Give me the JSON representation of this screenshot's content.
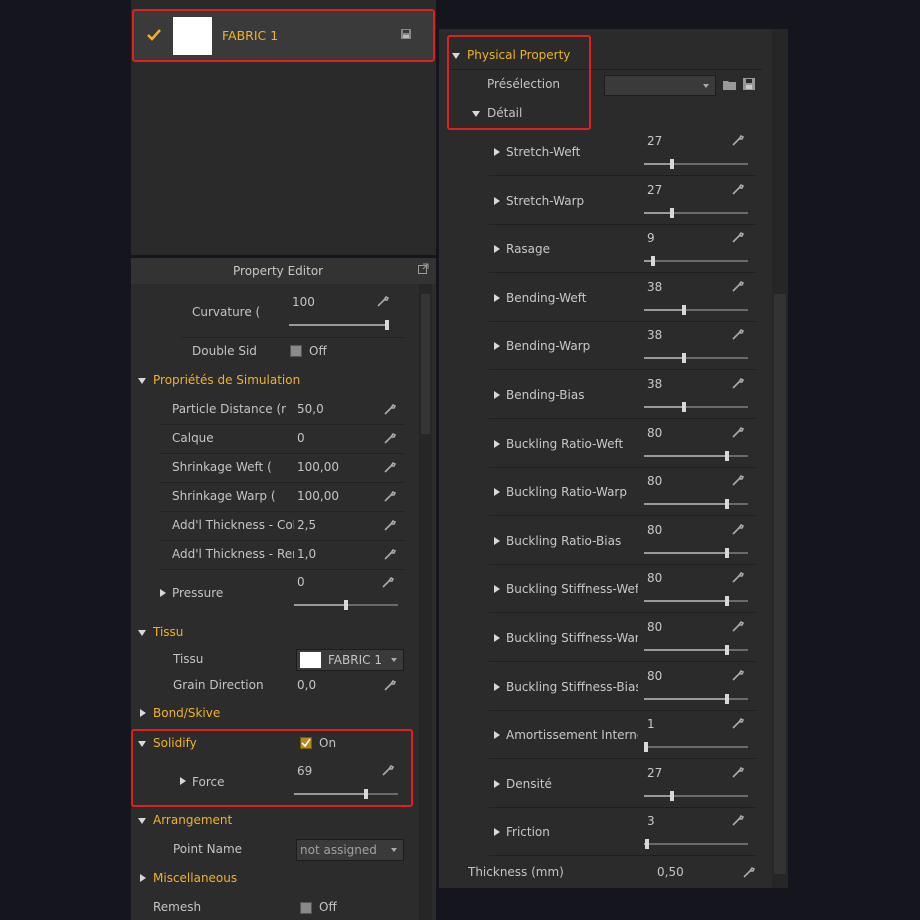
{
  "fabric_list": {
    "item_name": "FABRIC 1"
  },
  "property_editor": {
    "title": "Property Editor",
    "curvature": {
      "label": "Curvature (°",
      "value": "100",
      "level": 1.0
    },
    "double_side": {
      "label": "Double Side",
      "value": "Off"
    },
    "simulation": {
      "title": "Propriétés de Simulation",
      "rows": [
        {
          "label": "Particle Distance (r",
          "value": "50,0"
        },
        {
          "label": "Calque",
          "value": "0"
        },
        {
          "label": "Shrinkage Weft (",
          "value": "100,00"
        },
        {
          "label": "Shrinkage Warp (",
          "value": "100,00"
        },
        {
          "label": "Add'l Thickness - Colli",
          "value": "2,5"
        },
        {
          "label": "Add'l Thickness - Ren",
          "value": "1,0"
        }
      ],
      "pressure": {
        "label": "Pressure",
        "value": "0",
        "level": 0.5
      }
    },
    "tissu": {
      "title": "Tissu",
      "fabric_label": "Tissu",
      "fabric_value": "FABRIC 1",
      "grain_label": "Grain Direction",
      "grain_value": "0,0"
    },
    "bond": {
      "title": "Bond/Skive"
    },
    "solidify": {
      "title": "Solidify",
      "state": "On",
      "force": {
        "label": "Force",
        "value": "69",
        "level": 0.69
      }
    },
    "arrangement": {
      "title": "Arrangement",
      "point_label": "Point Name",
      "point_value": "not assigned"
    },
    "misc": {
      "title": "Miscellaneous"
    },
    "remesh": {
      "label": "Remesh",
      "value": "Off"
    }
  },
  "physical_property": {
    "title": "Physical Property",
    "preselection_label": "Présélection",
    "detail_label": "Détail",
    "rows": [
      {
        "label": "Stretch-Weft",
        "value": "27",
        "level": 0.27
      },
      {
        "label": "Stretch-Warp",
        "value": "27",
        "level": 0.27
      },
      {
        "label": "Rasage",
        "value": "9",
        "level": 0.09
      },
      {
        "label": "Bending-Weft",
        "value": "38",
        "level": 0.38
      },
      {
        "label": "Bending-Warp",
        "value": "38",
        "level": 0.38
      },
      {
        "label": "Bending-Bias",
        "value": "38",
        "level": 0.38
      },
      {
        "label": "Buckling Ratio-Weft",
        "value": "80",
        "level": 0.8
      },
      {
        "label": "Buckling Ratio-Warp",
        "value": "80",
        "level": 0.8
      },
      {
        "label": "Buckling Ratio-Bias",
        "value": "80",
        "level": 0.8
      },
      {
        "label": "Buckling Stiffness-Weft",
        "value": "80",
        "level": 0.8
      },
      {
        "label": "Buckling Stiffness-Warp",
        "value": "80",
        "level": 0.8
      },
      {
        "label": "Buckling Stiffness-Bias",
        "value": "80",
        "level": 0.8
      },
      {
        "label": "Amortissement Interne",
        "value": "1",
        "level": 0.01
      },
      {
        "label": "Densité",
        "value": "27",
        "level": 0.27
      },
      {
        "label": "Friction",
        "value": "3",
        "level": 0.03
      }
    ],
    "thickness": {
      "label": "Thickness (mm)",
      "value": "0,50"
    }
  },
  "colors": {
    "accent": "#f0b229",
    "highlight": "#e02020",
    "panel": "#2a2a2a"
  },
  "icons": [
    "checkmark-icon",
    "save-icon",
    "popout-icon",
    "wrench-icon",
    "folder-icon",
    "disk-icon"
  ]
}
